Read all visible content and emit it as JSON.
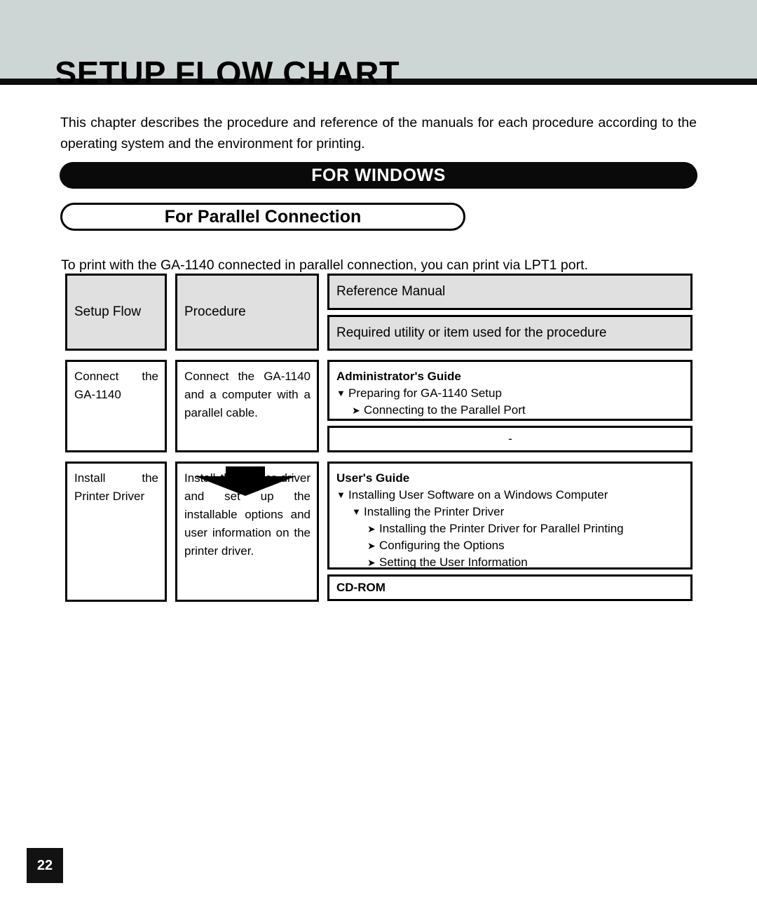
{
  "chapter": {
    "title": "SETUP FLOW CHART",
    "intro": "This chapter describes the procedure and reference of the manuals for each procedure according to the operating system and the environment for printing."
  },
  "section": {
    "banner_label": "FOR WINDOWS",
    "subsection_label": "For Parallel Connection",
    "lead_in": "To print with the GA-1140 connected in parallel connection, you can print via LPT1 port."
  },
  "flow_table": {
    "header": {
      "setup_flow": "Setup Flow",
      "procedure": "Procedure",
      "reference_manual": "Reference Manual",
      "required_utility": "Required utility or item used for the procedure"
    },
    "rows": [
      {
        "setup_flow": "Connect the GA-1140",
        "procedure": "Connect the GA-1140 and a computer with a parallel cable.",
        "reference": {
          "guide_title": "Administrator's Guide",
          "items": [
            {
              "bullet": "triangle-down-icon",
              "glyph": "▼",
              "level": 1,
              "text": "Preparing for GA-1140 Setup"
            },
            {
              "bullet": "arrow-right-icon",
              "glyph": "➤",
              "level": 2,
              "text": "Connecting to the Parallel Port"
            }
          ]
        },
        "utility": "-"
      },
      {
        "setup_flow": "Install the Printer Driver",
        "procedure": "Install the printer driver and set up the installable options and user information on the printer driver.",
        "reference": {
          "guide_title": "User's Guide",
          "items": [
            {
              "bullet": "triangle-down-icon",
              "glyph": "▼",
              "level": 1,
              "text": "Installing User Software on a Windows Computer"
            },
            {
              "bullet": "triangle-down-icon",
              "glyph": "▼",
              "level": 2,
              "text": "Installing the Printer Driver"
            },
            {
              "bullet": "arrow-right-icon",
              "glyph": "➤",
              "level": 3,
              "text": "Installing the Printer Driver for Parallel Printing"
            },
            {
              "bullet": "arrow-right-icon",
              "glyph": "➤",
              "level": 3,
              "text": "Configuring the Options"
            },
            {
              "bullet": "arrow-right-icon",
              "glyph": "➤",
              "level": 3,
              "text": "Setting the User Information"
            }
          ]
        },
        "utility": "CD-ROM"
      }
    ],
    "flow_connector": "arrow-down-block-icon"
  },
  "footer": {
    "page_number": "22"
  },
  "colors": {
    "header_band": "#ced6d5",
    "rule": "#0d0d0d",
    "table_header_fill": "#dfe0df",
    "banner_fill": "#0a0a0a",
    "page_number_fill": "#121212"
  }
}
